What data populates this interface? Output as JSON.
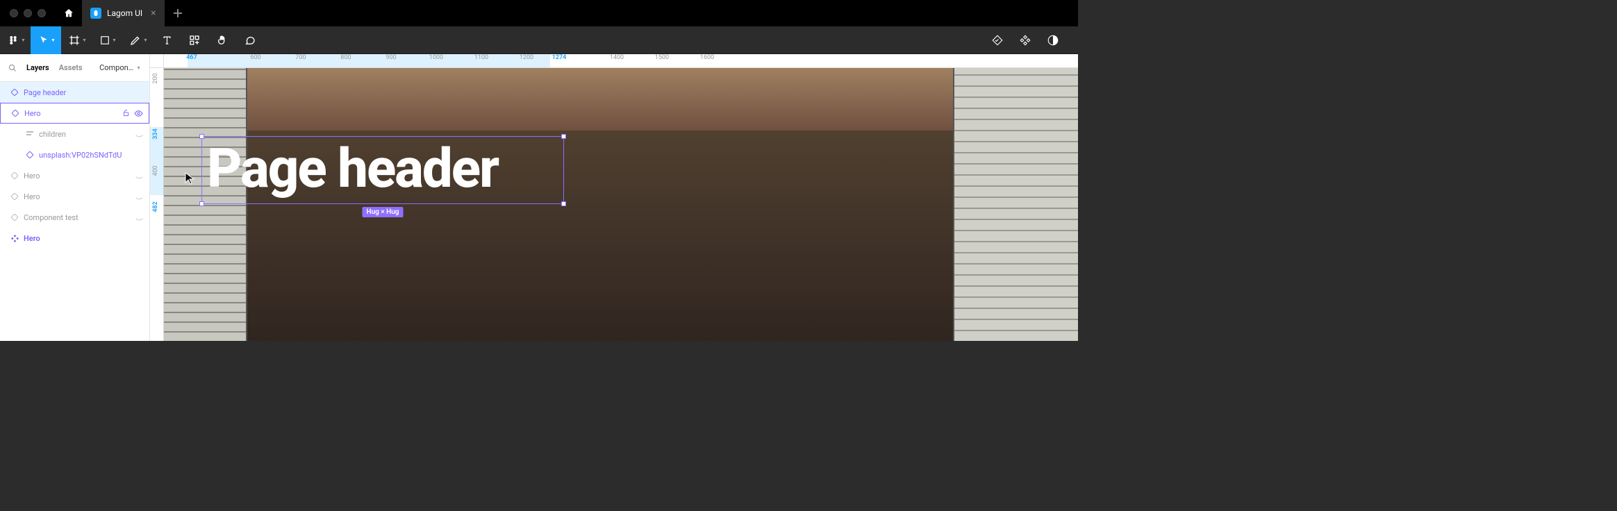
{
  "titlebar": {
    "tab_title": "Lagom UI"
  },
  "panel": {
    "tab_layers": "Layers",
    "tab_assets": "Assets",
    "page_selector": "Compon…"
  },
  "layers": {
    "page_header": "Page header",
    "hero_selected": "Hero",
    "children": "children",
    "unsplash": "unsplash:VP02hSNdTdU",
    "hero2": "Hero",
    "hero3": "Hero",
    "component_test": "Component test",
    "hero_master": "Hero"
  },
  "ruler_h": {
    "t467": "467",
    "t600": "600",
    "t700": "700",
    "t800": "800",
    "t900": "900",
    "t1000": "1000",
    "t1100": "1100",
    "t1200": "1200",
    "t1274": "1274",
    "t1400": "1400",
    "t1500": "1500",
    "t1600": "1600"
  },
  "ruler_v": {
    "t200": "200",
    "t334": "334",
    "t400": "400",
    "t482": "482"
  },
  "canvas": {
    "heading_text": "Page header",
    "sizing_badge": "Hug × Hug"
  },
  "colors": {
    "accent": "#18a0fb",
    "instance": "#7b61ff",
    "selection": "#8f6fff"
  }
}
